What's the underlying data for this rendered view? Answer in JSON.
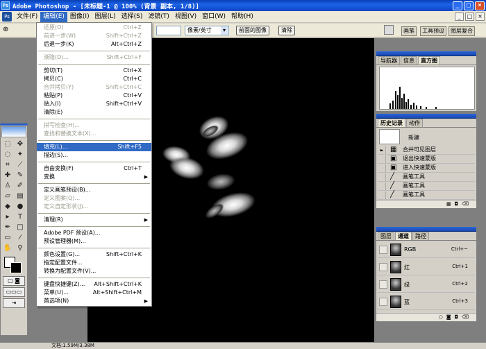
{
  "title": "Adobe Photoshop - [未标题-1 @ 100% (背景 副本, 1/8)]",
  "app_icon": "photoshop-icon",
  "window_controls": {
    "min": "_",
    "max": "□",
    "close": "×"
  },
  "menu": {
    "items": [
      "文件(F)",
      "编辑(E)",
      "图像(I)",
      "图层(L)",
      "选择(S)",
      "滤镜(T)",
      "视图(V)",
      "窗口(W)",
      "帮助(H)"
    ],
    "active": "编辑(E)"
  },
  "options": {
    "tool_glyph": "⊕",
    "unit_select": "像素/英寸",
    "front_image_button": "前面的图像",
    "clear_button": "清除",
    "panel_tabs": [
      "画笔",
      "工具预设",
      "图层复合"
    ]
  },
  "edit_menu": [
    {
      "label": "还原(O)",
      "shortcut": "Ctrl+Z",
      "disabled": true
    },
    {
      "label": "前进一步(W)",
      "shortcut": "Shift+Ctrl+Z",
      "disabled": true
    },
    {
      "label": "后退一步(K)",
      "shortcut": "Alt+Ctrl+Z"
    },
    {
      "sep": true
    },
    {
      "label": "渐隐(D)...",
      "shortcut": "Shift+Ctrl+F",
      "disabled": true
    },
    {
      "sep": true
    },
    {
      "label": "剪切(T)",
      "shortcut": "Ctrl+X"
    },
    {
      "label": "拷贝(C)",
      "shortcut": "Ctrl+C"
    },
    {
      "label": "合并拷贝(Y)",
      "shortcut": "Shift+Ctrl+C",
      "disabled": true
    },
    {
      "label": "粘贴(P)",
      "shortcut": "Ctrl+V"
    },
    {
      "label": "贴入(I)",
      "shortcut": "Shift+Ctrl+V"
    },
    {
      "label": "清除(E)"
    },
    {
      "sep": true
    },
    {
      "label": "拼写检查(H)...",
      "disabled": true
    },
    {
      "label": "查找和替换文本(X)...",
      "disabled": true
    },
    {
      "sep": true
    },
    {
      "label": "填充(L)...",
      "shortcut": "Shift+F5",
      "highlighted": true
    },
    {
      "label": "描边(S)..."
    },
    {
      "sep": true
    },
    {
      "label": "自由变换(F)",
      "shortcut": "Ctrl+T"
    },
    {
      "label": "变换",
      "submenu": true
    },
    {
      "sep": true
    },
    {
      "label": "定义画笔预设(B)..."
    },
    {
      "label": "定义图案(Q)...",
      "disabled": true
    },
    {
      "label": "定义自定形状(J)...",
      "disabled": true
    },
    {
      "sep": true
    },
    {
      "label": "清理(R)",
      "submenu": true
    },
    {
      "sep": true
    },
    {
      "label": "Adobe PDF 预设(A)..."
    },
    {
      "label": "预设管理器(M)..."
    },
    {
      "sep": true
    },
    {
      "label": "颜色设置(G)...",
      "shortcut": "Shift+Ctrl+K"
    },
    {
      "label": "指定配置文件..."
    },
    {
      "label": "转换为配置文件(V)..."
    },
    {
      "sep": true
    },
    {
      "label": "键盘快捷键(Z)...",
      "shortcut": "Alt+Shift+Ctrl+K"
    },
    {
      "label": "菜单(U)...",
      "shortcut": "Alt+Shift+Ctrl+M"
    },
    {
      "label": "首选项(N)",
      "submenu": true
    }
  ],
  "navigator_panel": {
    "tabs": [
      "导航器",
      "信息",
      "直方图"
    ],
    "active": "直方图"
  },
  "history_panel": {
    "tabs": [
      "历史记录",
      "动作"
    ],
    "active": "历史记录",
    "snapshot": "新建",
    "steps": [
      {
        "icon": "merge-icon",
        "glyph": "▦",
        "label": "合并可见图层"
      },
      {
        "icon": "quickmask-icon",
        "glyph": "▣",
        "label": "退出快速蒙版"
      },
      {
        "icon": "quickmask-icon",
        "glyph": "▣",
        "label": "进入快速蒙版"
      },
      {
        "icon": "brush-icon",
        "glyph": "╱",
        "label": "画笔工具"
      },
      {
        "icon": "brush-icon",
        "glyph": "╱",
        "label": "画笔工具"
      },
      {
        "icon": "brush-icon",
        "glyph": "╱",
        "label": "画笔工具"
      }
    ]
  },
  "channels_panel": {
    "tabs": [
      "图层",
      "通道",
      "路径"
    ],
    "active": "通道",
    "rows": [
      {
        "name": "RGB",
        "key": "Ctrl+~"
      },
      {
        "name": "红",
        "key": "Ctrl+1"
      },
      {
        "name": "绿",
        "key": "Ctrl+2"
      },
      {
        "name": "蓝",
        "key": "Ctrl+3"
      }
    ]
  },
  "status": {
    "doc": "文档:1.59M/3.38M"
  }
}
